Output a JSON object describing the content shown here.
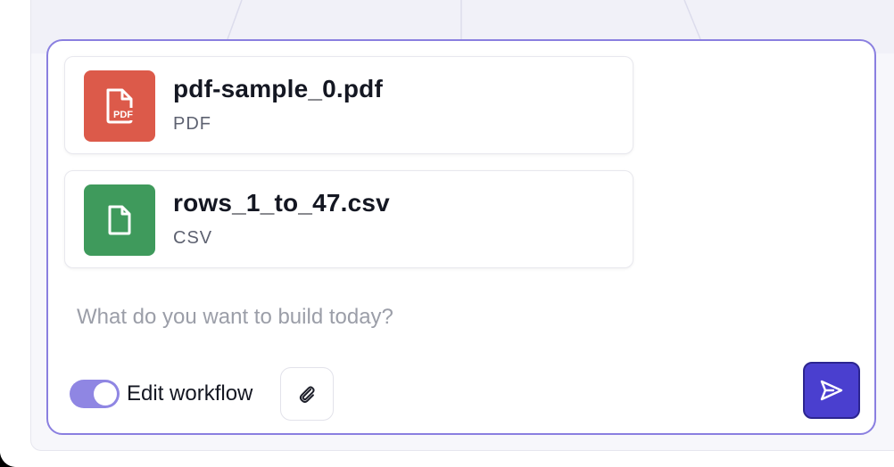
{
  "attachments": [
    {
      "name": "pdf-sample_0.pdf",
      "type": "PDF",
      "icon": "pdf-file-icon",
      "color": "#dc5a4a",
      "tile_text": "PDF"
    },
    {
      "name": "rows_1_to_47.csv",
      "type": "CSV",
      "icon": "file-icon",
      "color": "#3f9a5c"
    }
  ],
  "composer": {
    "placeholder": "What do you want to build today?",
    "toggle_label": "Edit workflow",
    "toggle_on": true
  },
  "icons": {
    "attach": "paperclip-icon",
    "send": "send-icon"
  },
  "colors": {
    "accent": "#8a7fe0",
    "send": "#4a3fcf"
  }
}
